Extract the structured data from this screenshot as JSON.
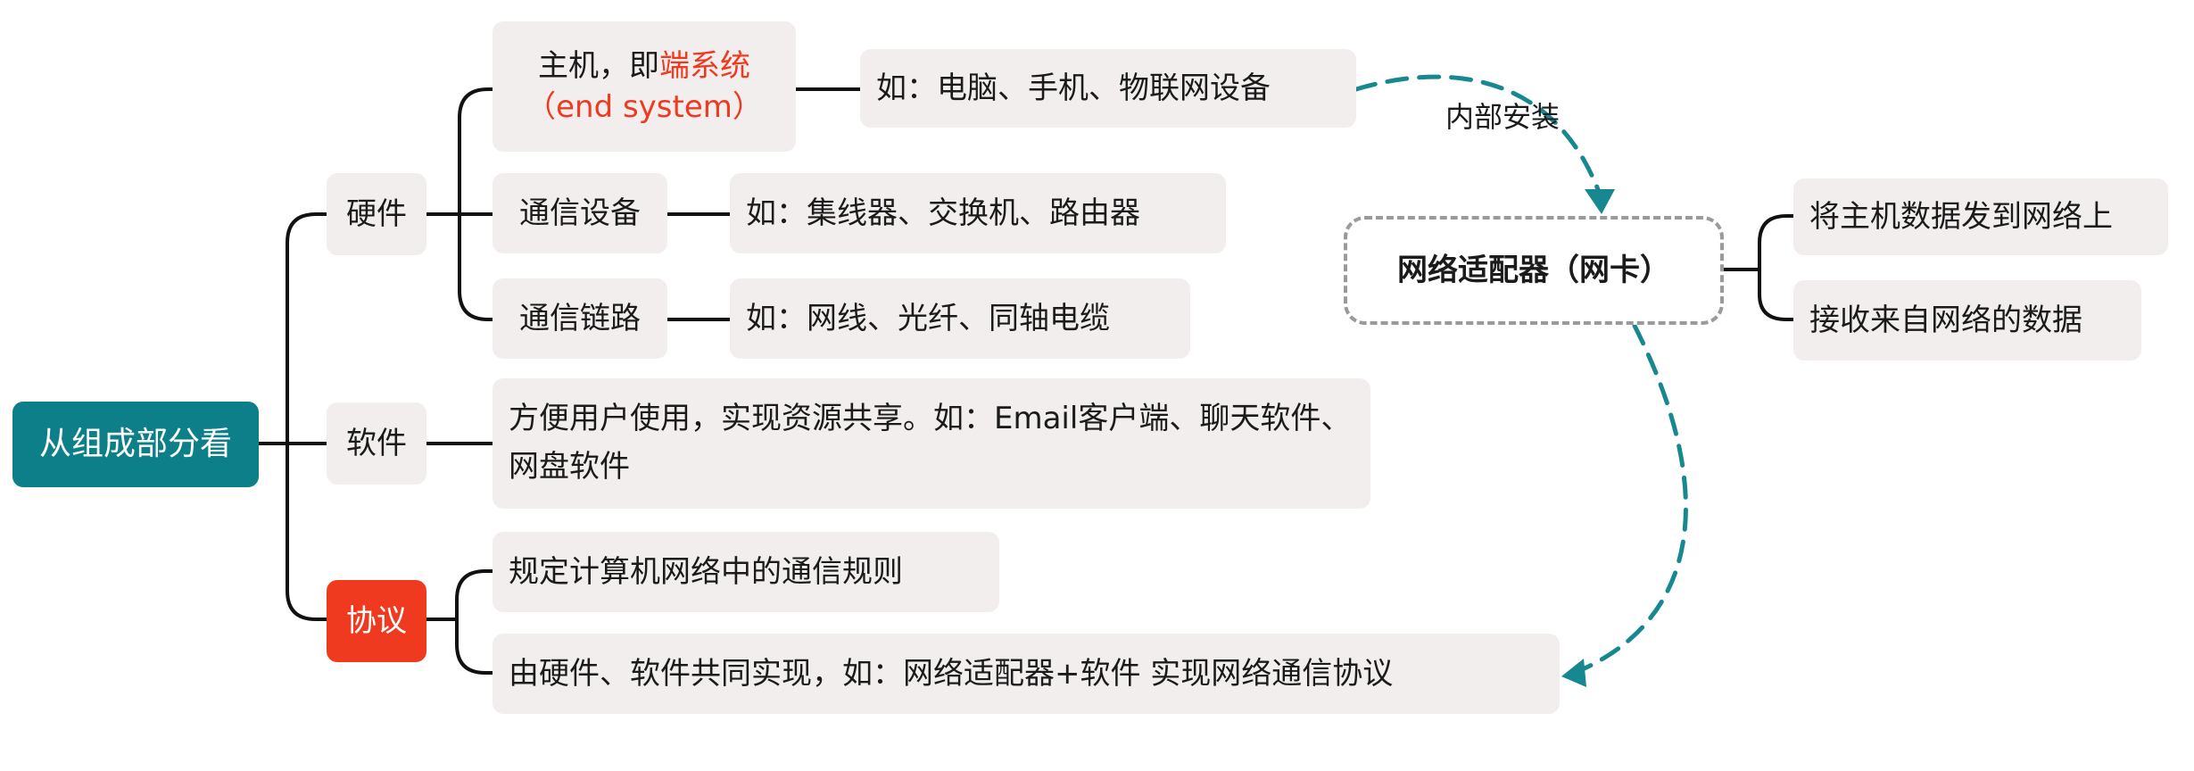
{
  "root": {
    "label": "从组成部分看"
  },
  "branches": {
    "hardware": {
      "label": "硬件"
    },
    "software": {
      "label": "软件"
    },
    "protocol": {
      "label": "协议"
    }
  },
  "hardware_items": {
    "host": {
      "label_prefix": "主机，即",
      "label_highlight": "端系统",
      "label_sub": "（end system）"
    },
    "host_example": "如：电脑、手机、物联网设备",
    "comm_device": "通信设备",
    "comm_device_example": "如：集线器、交换机、路由器",
    "comm_link": "通信链路",
    "comm_link_example": "如：网线、光纤、同轴电缆"
  },
  "software_item": "方便用户使用，实现资源共享。如：Email客户端、聊天软件、网盘软件",
  "protocol_items": {
    "rule": "规定计算机网络中的通信规则",
    "impl": "由硬件、软件共同实现，如：网络适配器+软件 实现网络通信协议"
  },
  "adapter": {
    "label": "网络适配器（网卡）",
    "install_label": "内部安装",
    "functions": [
      "将主机数据发到网络上",
      "接收来自网络的数据"
    ]
  },
  "colors": {
    "root_bg": "#0c7f89",
    "protocol_bg": "#ef3a1f",
    "highlight": "#ef3a1f",
    "node_bg": "#f3eeee",
    "connector": "#111111",
    "dashed_arrow": "#17888f",
    "adapter_border": "#9a9a9a"
  }
}
